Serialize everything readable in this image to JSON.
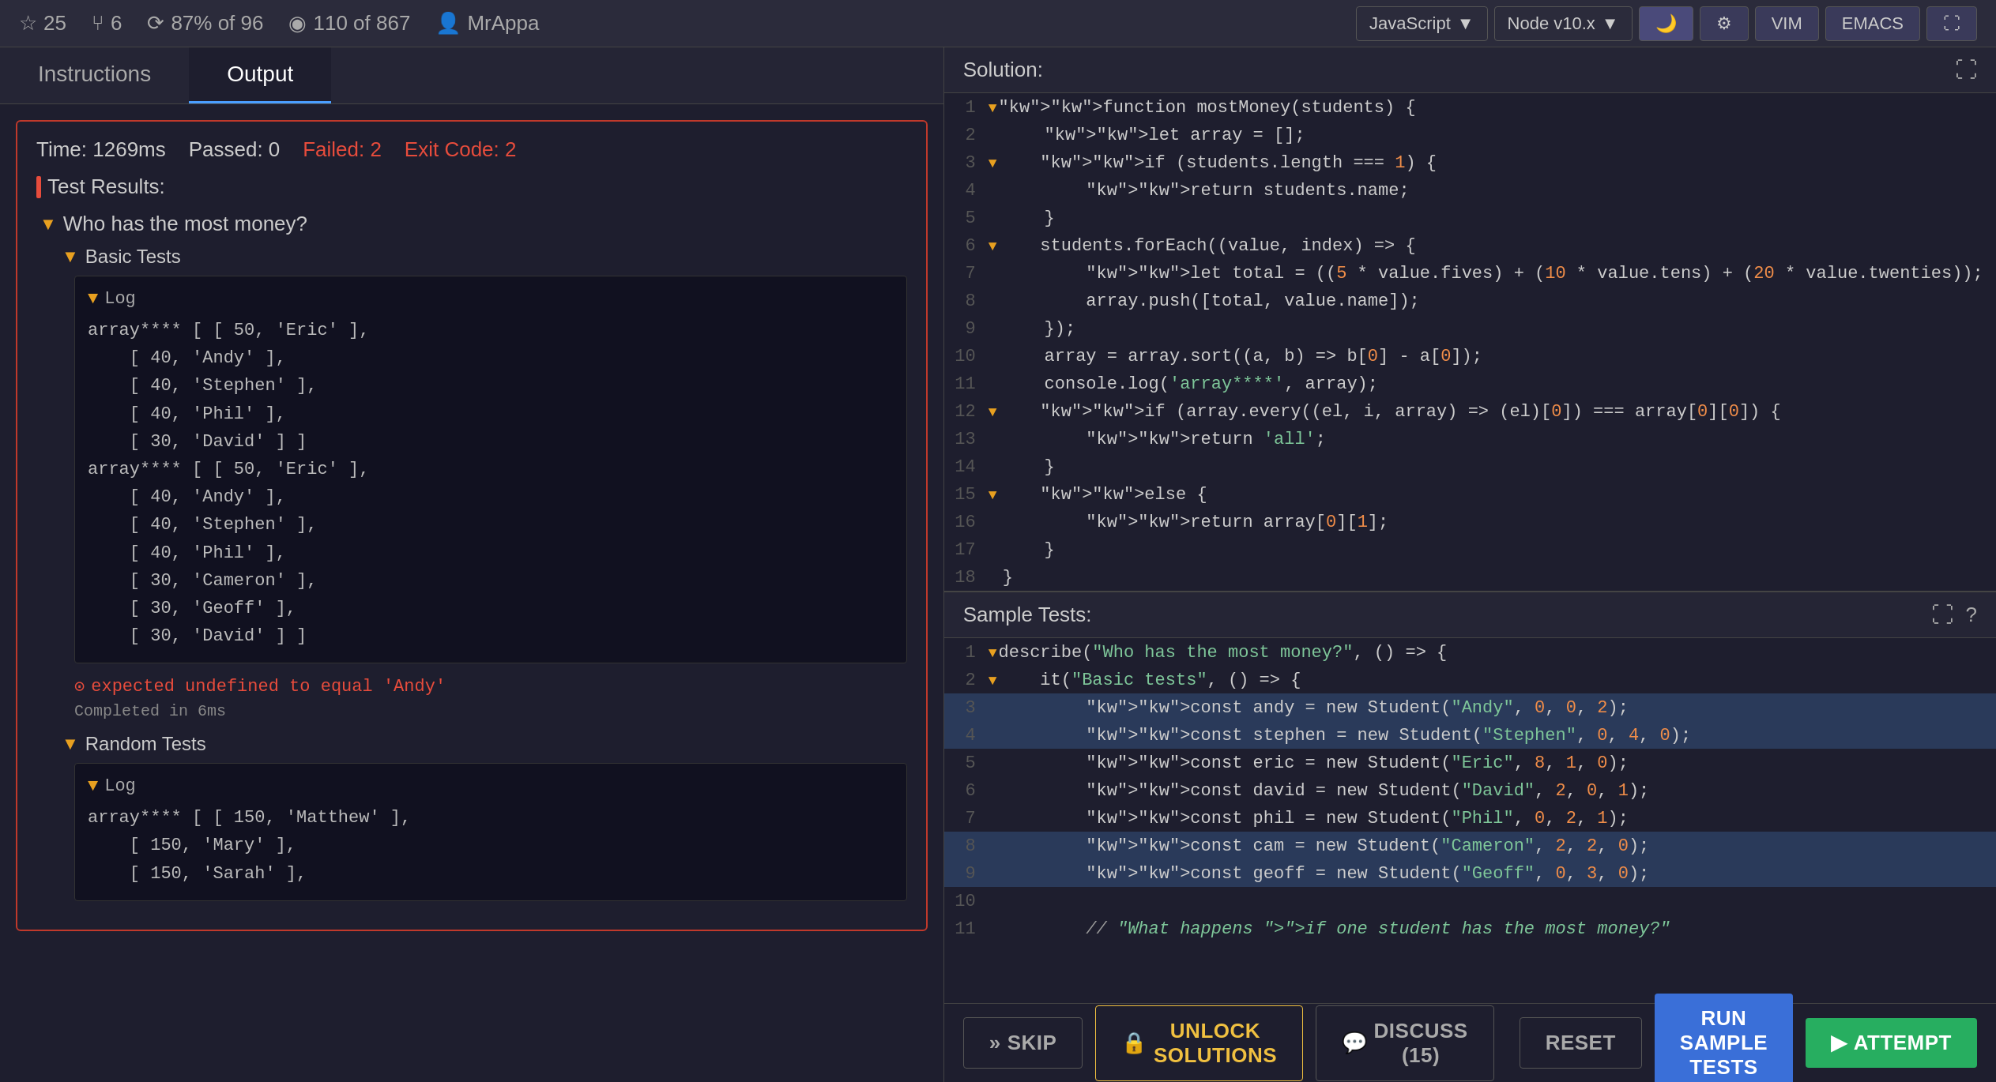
{
  "topbar": {
    "stars": "25",
    "forks": "6",
    "completion": "87% of 96",
    "solutions": "110 of 867",
    "user": "MrAppa",
    "language": "JavaScript",
    "node_version": "Node v10.x",
    "editor_vim": "VIM",
    "editor_emacs": "EMACS"
  },
  "tabs": {
    "instructions": "Instructions",
    "output": "Output"
  },
  "test_result": {
    "time": "Time: 1269ms",
    "passed": "Passed: 0",
    "failed": "Failed: 2",
    "exit_code": "Exit Code: 2"
  },
  "test_results_label": "Test Results:",
  "who_section": {
    "title": "Who has the most money?",
    "basic_tests_label": "Basic Tests",
    "log_label": "Log",
    "log_content": "array**** [ [ 50, 'Eric' ],\n    [ 40, 'Andy' ],\n    [ 40, 'Stephen' ],\n    [ 40, 'Phil' ],\n    [ 30, 'David' ] ]\narray**** [ [ 50, 'Eric' ],\n    [ 40, 'Andy' ],\n    [ 40, 'Stephen' ],\n    [ 40, 'Phil' ],\n    [ 30, 'Cameron' ],\n    [ 30, 'Geoff' ],\n    [ 30, 'David' ] ]",
    "error_msg": "expected undefined to equal 'Andy'",
    "completed_msg": "Completed in 6ms",
    "random_tests_label": "Random Tests",
    "random_log_label": "Log",
    "random_log_content": "array**** [ [ 150, 'Matthew' ],\n    [ 150, 'Mary' ],\n    [ 150, 'Sarah' ],"
  },
  "solution": {
    "title": "Solution:",
    "lines": [
      {
        "num": "1",
        "fold": true,
        "content": "function mostMoney(students) {"
      },
      {
        "num": "2",
        "fold": false,
        "content": "    let array = [];"
      },
      {
        "num": "3",
        "fold": true,
        "content": "    if (students.length === 1) {"
      },
      {
        "num": "4",
        "fold": false,
        "content": "        return students.name;"
      },
      {
        "num": "5",
        "fold": false,
        "content": "    }"
      },
      {
        "num": "6",
        "fold": true,
        "content": "    students.forEach((value, index) => {"
      },
      {
        "num": "7",
        "fold": false,
        "content": "        let total = ((5 * value.fives) + (10 * value.tens) + (20 * value.twenties));"
      },
      {
        "num": "8",
        "fold": false,
        "content": "        array.push([total, value.name]);"
      },
      {
        "num": "9",
        "fold": false,
        "content": "    });"
      },
      {
        "num": "10",
        "fold": false,
        "content": "    array = array.sort((a, b) => b[0] - a[0]);"
      },
      {
        "num": "11",
        "fold": false,
        "content": "    console.log('array****', array);"
      },
      {
        "num": "12",
        "fold": true,
        "content": "    if (array.every((el, i, array) => (el)[0]) === array[0][0]) {"
      },
      {
        "num": "13",
        "fold": false,
        "content": "        return 'all';"
      },
      {
        "num": "14",
        "fold": false,
        "content": "    }"
      },
      {
        "num": "15",
        "fold": true,
        "content": "    else {"
      },
      {
        "num": "16",
        "fold": false,
        "content": "        return array[0][1];"
      },
      {
        "num": "17",
        "fold": false,
        "content": "    }"
      },
      {
        "num": "18",
        "fold": false,
        "content": "}"
      }
    ]
  },
  "sample_tests": {
    "title": "Sample Tests:",
    "lines": [
      {
        "num": "1",
        "fold": true,
        "content": "describe(\"Who has the most money?\", () => {",
        "highlighted": false
      },
      {
        "num": "2",
        "fold": true,
        "content": "    it(\"Basic tests\", () => {",
        "highlighted": false
      },
      {
        "num": "3",
        "fold": false,
        "content": "        const andy = new Student(\"Andy\", 0, 0, 2);",
        "highlighted": true
      },
      {
        "num": "4",
        "fold": false,
        "content": "        const stephen = new Student(\"Stephen\", 0, 4, 0);",
        "highlighted": true
      },
      {
        "num": "5",
        "fold": false,
        "content": "        const eric = new Student(\"Eric\", 8, 1, 0);",
        "highlighted": false
      },
      {
        "num": "6",
        "fold": false,
        "content": "        const david = new Student(\"David\", 2, 0, 1);",
        "highlighted": false
      },
      {
        "num": "7",
        "fold": false,
        "content": "        const phil = new Student(\"Phil\", 0, 2, 1);",
        "highlighted": false
      },
      {
        "num": "8",
        "fold": false,
        "content": "        const cam = new Student(\"Cameron\", 2, 2, 0);",
        "highlighted": true
      },
      {
        "num": "9",
        "fold": false,
        "content": "        const geoff = new Student(\"Geoff\", 0, 3, 0);",
        "highlighted": true
      },
      {
        "num": "10",
        "fold": false,
        "content": "",
        "highlighted": false
      },
      {
        "num": "11",
        "fold": false,
        "content": "        // \"What happens if one student has the most money?\"",
        "highlighted": false
      }
    ]
  },
  "bottom_bar": {
    "skip_label": "SKIP",
    "unlock_label": "UNLOCK SOLUTIONS",
    "discuss_label": "DISCUSS (15)",
    "reset_label": "RESET",
    "run_label": "RUN SAMPLE TESTS",
    "attempt_label": "ATTEMPT"
  }
}
